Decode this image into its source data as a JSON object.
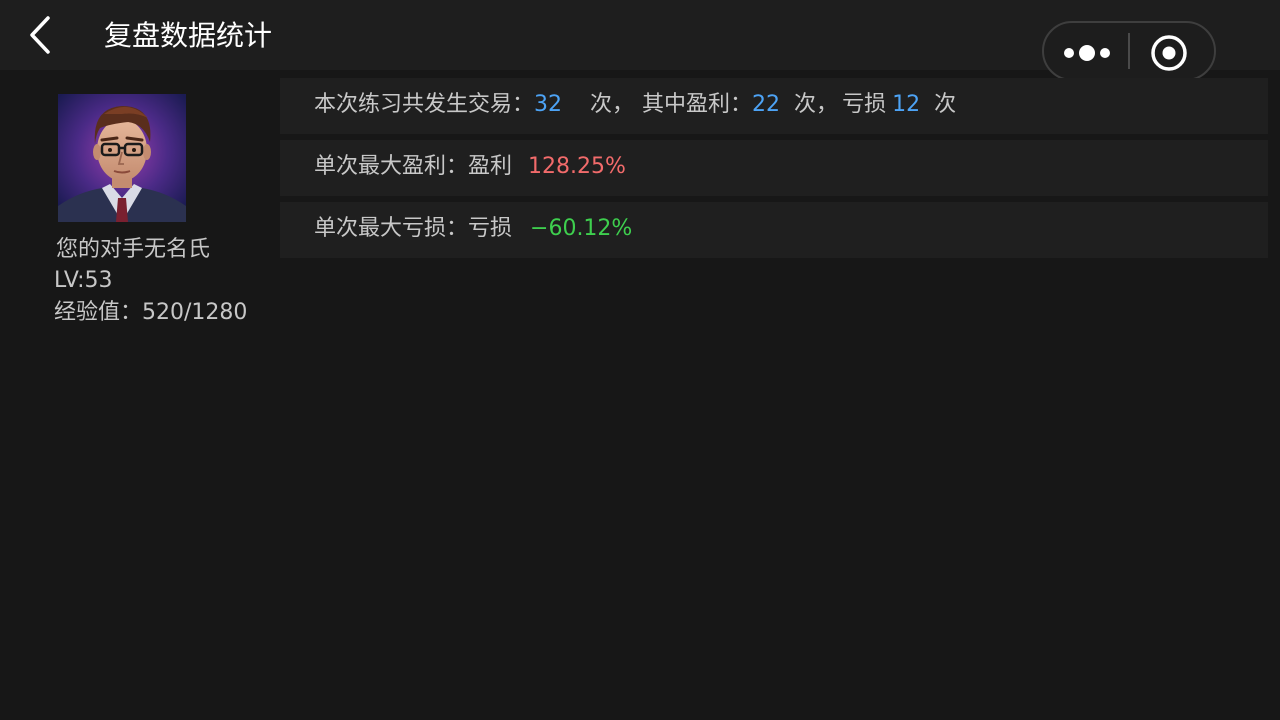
{
  "header": {
    "title": "复盘数据统计",
    "back_icon": "chevron-left-icon",
    "more_icon": "more-dots-icon",
    "close_icon": "target-close-icon"
  },
  "opponent": {
    "name": "您的对手无名氏",
    "level": "LV:53",
    "exp": "经验值：520/1280"
  },
  "stats": {
    "trades_prefix": "本次练习共发生交易：",
    "total_trades": "32",
    "times1": "次，",
    "profit_prefix": "其中盈利：",
    "profit_count": "22",
    "times2": "次，",
    "loss_prefix": "亏损",
    "loss_count": "12",
    "times3": "次",
    "max_profit_label": "单次最大盈利：盈利",
    "max_profit_value": "128.25%",
    "max_loss_label": "单次最大亏损：亏损",
    "max_loss_value": "−60.12%"
  },
  "colors": {
    "background": "#171717",
    "row_bg": "#1f1f1f",
    "count_blue": "#4da3f5",
    "profit_red": "#f26b6b",
    "loss_green": "#3ecf4e"
  }
}
